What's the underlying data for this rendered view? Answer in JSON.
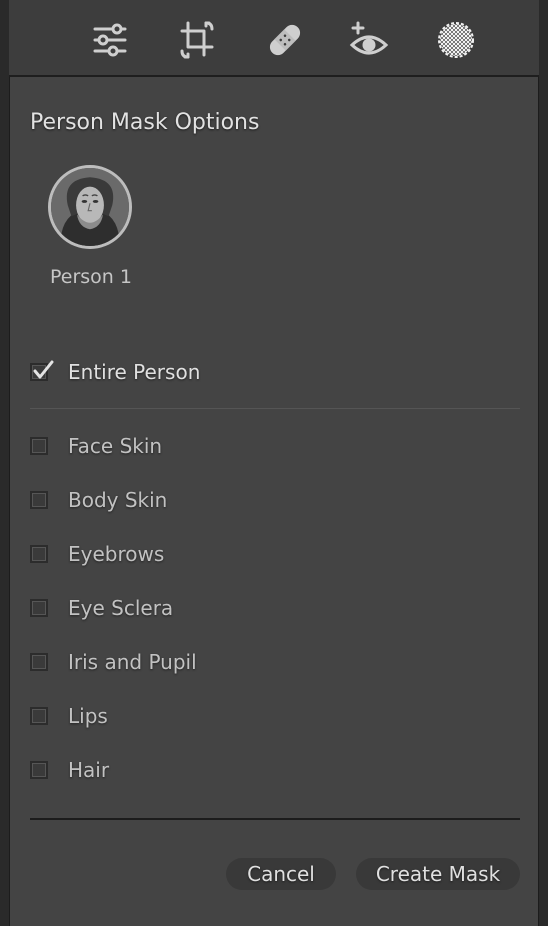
{
  "toolbar": {
    "tools": [
      {
        "icon": "sliders-icon"
      },
      {
        "icon": "crop-rotate-icon"
      },
      {
        "icon": "healing-bandage-icon"
      },
      {
        "icon": "red-eye-icon"
      },
      {
        "icon": "masking-icon"
      }
    ]
  },
  "panel": {
    "title": "Person Mask Options",
    "person": {
      "label": "Person 1"
    }
  },
  "options": {
    "entire_person": {
      "label": "Entire Person",
      "checked": true
    },
    "items": [
      {
        "label": "Face Skin",
        "checked": false
      },
      {
        "label": "Body Skin",
        "checked": false
      },
      {
        "label": "Eyebrows",
        "checked": false
      },
      {
        "label": "Eye Sclera",
        "checked": false
      },
      {
        "label": "Iris and Pupil",
        "checked": false
      },
      {
        "label": "Lips",
        "checked": false
      },
      {
        "label": "Hair",
        "checked": false
      }
    ]
  },
  "actions": {
    "cancel_label": "Cancel",
    "create_label": "Create Mask"
  },
  "colors": {
    "panel_bg": "#444444",
    "toolbar_bg": "#3d3d3d",
    "text": "#d6d6d6"
  }
}
